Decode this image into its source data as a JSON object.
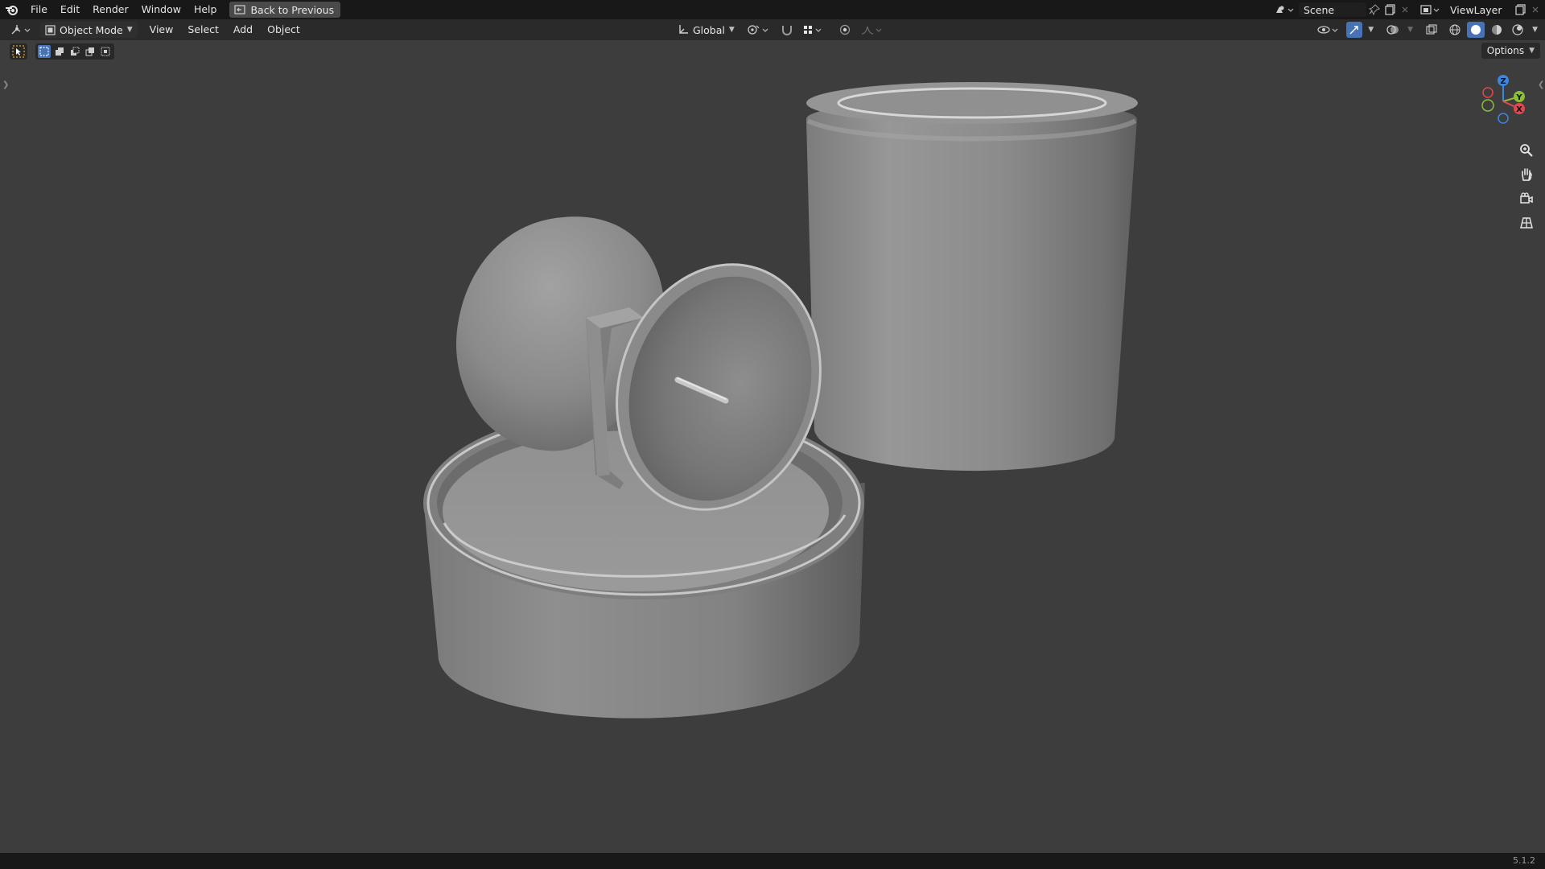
{
  "menu": {
    "file": "File",
    "edit": "Edit",
    "render": "Render",
    "window": "Window",
    "help": "Help",
    "back_to_previous": "Back to Previous"
  },
  "topbar_right": {
    "scene_name": "Scene",
    "view_layer_name": "ViewLayer"
  },
  "header": {
    "mode": "Object Mode",
    "view": "View",
    "select": "Select",
    "add": "Add",
    "object": "Object",
    "transform_orientation": "Global"
  },
  "toolbar": {
    "options_label": "Options"
  },
  "gizmo": {
    "z_label": "Z",
    "y_label": "Y",
    "x_label": "X"
  },
  "status": {
    "version": "5.1.2"
  },
  "colors": {
    "background": "#3d3d3d",
    "accent_blue": "#4772b3",
    "axis_x": "#e0474f",
    "axis_y": "#8cbe3a",
    "axis_z": "#3b86e0"
  }
}
